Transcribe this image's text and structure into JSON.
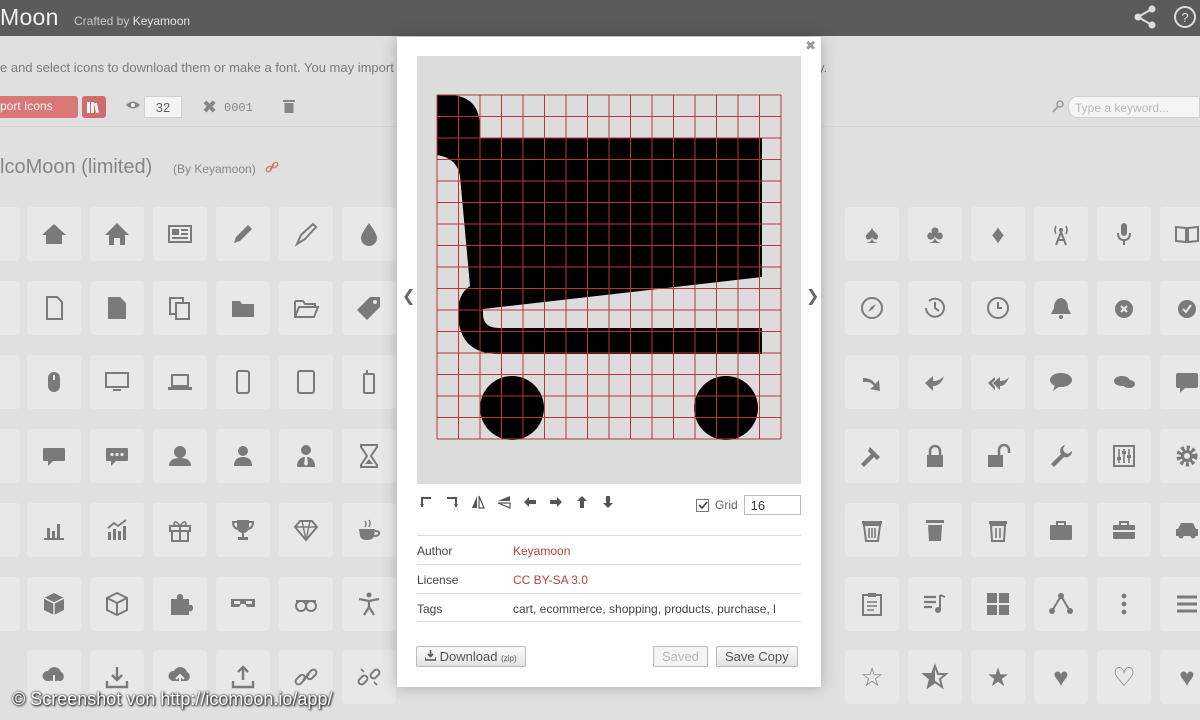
{
  "app": {
    "brand": "Moon",
    "crafted_prefix": "Crafted by",
    "crafted_author": "Keyamoon"
  },
  "top_icons": [
    "share-icon",
    "help-icon"
  ],
  "intro": {
    "text": "e and select icons to download them or make a font. You may import S",
    "tail": "y."
  },
  "toolbar": {
    "import_label": "port Icons",
    "icon_size": "32",
    "code_value": "0001",
    "search_placeholder": "Type a keyword..."
  },
  "icon_set": {
    "title": "lcoMoon (limited)",
    "by": "(By Keyamoon)"
  },
  "modal": {
    "grid_label": "Grid",
    "grid_value": "16",
    "grid_checked": true,
    "author_key": "Author",
    "author_val": "Keyamoon",
    "license_key": "License",
    "license_val": "CC BY-SA 3.0",
    "tags_key": "Tags",
    "tags_val": "cart, ecommerce, shopping, products, purchase, l",
    "download_label": "Download",
    "download_note": "(zip)",
    "saved_label": "Saved",
    "save_copy_label": "Save Copy",
    "tools": [
      "rotate-left-icon",
      "rotate-right-icon",
      "flip-horizontal-icon",
      "flip-vertical-icon",
      "move-left-icon",
      "move-right-icon",
      "move-up-icon",
      "move-down-icon"
    ]
  },
  "watermark": "© Screenshot von http://icomoon.io/app/",
  "accent_color": "#d9534f",
  "link_color": "#b5433f"
}
